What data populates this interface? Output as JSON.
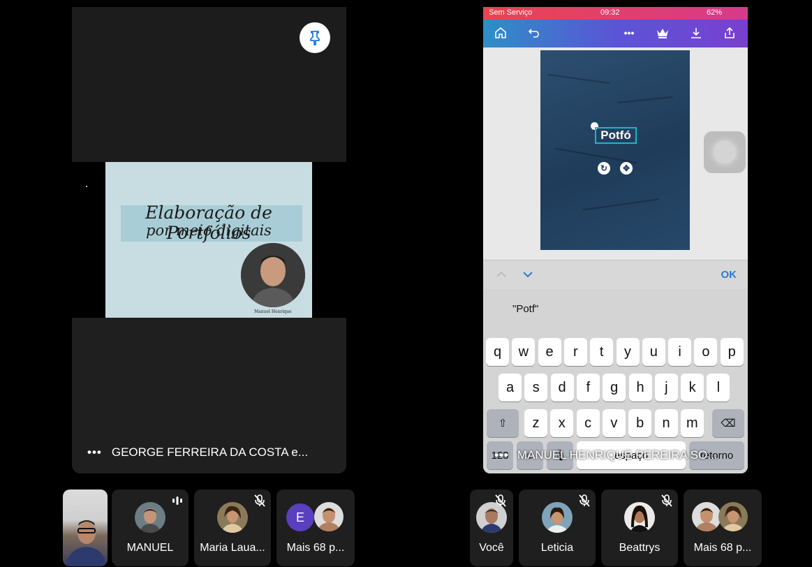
{
  "left_tile": {
    "slide_title_line1": "Elaboração de Portfólios",
    "slide_title_line2": "por meio digitais",
    "slide_caption": "Manuel Henrique",
    "presenter_label": "GEORGE FERREIRA DA COSTA e...",
    "pin_icon": "pin-icon"
  },
  "right_tile": {
    "status": {
      "carrier": "Sem Serviço",
      "time": "09:32",
      "battery": "62%"
    },
    "toolbar_icons": [
      "home-icon",
      "undo-icon",
      "more-icon",
      "crown-icon",
      "download-icon",
      "share-icon"
    ],
    "design_text": "Potfó",
    "kb_ok": "OK",
    "suggestion": "\"Potf\"",
    "keys_row1": [
      "q",
      "w",
      "e",
      "r",
      "t",
      "y",
      "u",
      "i",
      "o",
      "p"
    ],
    "keys_row2": [
      "a",
      "s",
      "d",
      "f",
      "g",
      "h",
      "j",
      "k",
      "l"
    ],
    "keys_row3": [
      "z",
      "x",
      "c",
      "v",
      "b",
      "n",
      "m"
    ],
    "key_123": "123",
    "key_space": "espaço",
    "key_return": "retorno",
    "presenter_label": "MANUEL HENRIQUE PEREIRA SO..."
  },
  "participants_left": [
    {
      "name": "MANUEL",
      "mic": "speaking"
    },
    {
      "name": "Maria Laua...",
      "mic": "muted"
    },
    {
      "name": "Mais 68 p...",
      "letter": "E"
    }
  ],
  "participants_right": [
    {
      "name": "Você",
      "mic": "muted"
    },
    {
      "name": "Leticia",
      "mic": "muted"
    },
    {
      "name": "Beattrys",
      "mic": "muted"
    },
    {
      "name": "Mais 68 p..."
    }
  ],
  "colors": {
    "background": "#000000",
    "tile": "#1f1f1f",
    "accent_purple": "#5a3fbf",
    "ok_blue": "#2d7ad6",
    "selection_cyan": "#18b7c9"
  }
}
